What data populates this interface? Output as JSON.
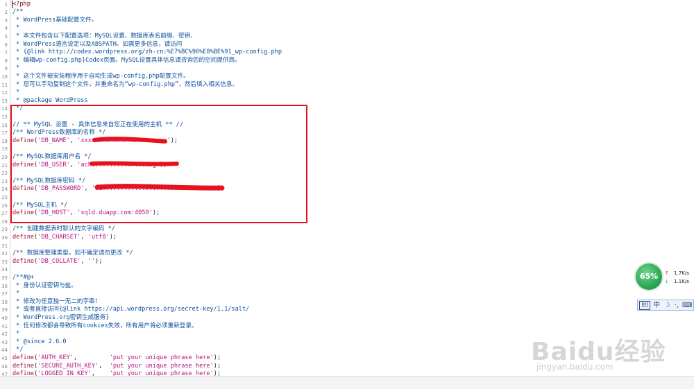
{
  "lines": [
    {
      "n": "1",
      "parts": [
        {
          "c": "keyword",
          "t": "<?php"
        }
      ]
    },
    {
      "n": "2",
      "parts": [
        {
          "c": "comment",
          "t": "/**"
        }
      ]
    },
    {
      "n": "3",
      "parts": [
        {
          "c": "comment",
          "t": " * WordPress基础配置文件。"
        }
      ]
    },
    {
      "n": "4",
      "parts": [
        {
          "c": "comment",
          "t": " *"
        }
      ]
    },
    {
      "n": "5",
      "parts": [
        {
          "c": "comment",
          "t": " * 本文件包含以下配置选项：MySQL设置、数据库表名前缀、密钥、"
        }
      ]
    },
    {
      "n": "6",
      "parts": [
        {
          "c": "comment",
          "t": " * WordPress语言设定以及ABSPATH。如需更多信息，请访问"
        }
      ]
    },
    {
      "n": "7",
      "parts": [
        {
          "c": "comment",
          "t": " * {@link http://codex.wordpress.org/zh-cn:%E7%BC%96%E8%BE%91_wp-config.php"
        }
      ]
    },
    {
      "n": "8",
      "parts": [
        {
          "c": "comment",
          "t": " * 编辑wp-config.php}Codex页面。MySQL设置具体信息请咨询您的空间提供商。"
        }
      ]
    },
    {
      "n": "9",
      "parts": [
        {
          "c": "comment",
          "t": " *"
        }
      ]
    },
    {
      "n": "10",
      "parts": [
        {
          "c": "comment",
          "t": " * 这个文件被安装程序用于自动生成wp-config.php配置文件。"
        }
      ]
    },
    {
      "n": "11",
      "parts": [
        {
          "c": "comment",
          "t": " * 您可以手动复制这个文件，并重命名为“wp-config.php”，然后填入相关信息。"
        }
      ]
    },
    {
      "n": "12",
      "parts": [
        {
          "c": "comment",
          "t": " *"
        }
      ]
    },
    {
      "n": "13",
      "parts": [
        {
          "c": "comment",
          "t": " * @package WordPress"
        }
      ]
    },
    {
      "n": "14",
      "parts": [
        {
          "c": "comment",
          "t": " */"
        }
      ]
    },
    {
      "n": "15",
      "parts": [
        {
          "c": "plain",
          "t": ""
        }
      ]
    },
    {
      "n": "16",
      "parts": [
        {
          "c": "comment",
          "t": "// ** MySQL 设置 - 具体信息来自您正在使用的主机 ** //"
        }
      ]
    },
    {
      "n": "17",
      "parts": [
        {
          "c": "comment",
          "t": "/** WordPress数据库的名称 */"
        }
      ]
    },
    {
      "n": "18",
      "parts": [
        {
          "c": "fn",
          "t": "define"
        },
        {
          "c": "punct",
          "t": "("
        },
        {
          "c": "str",
          "t": "'DB_NAME'"
        },
        {
          "c": "punct",
          "t": ", "
        },
        {
          "c": "str",
          "t": "'xxxxxxxxxxxxxxxxxxxxxxxx'"
        },
        {
          "c": "punct",
          "t": ");"
        }
      ]
    },
    {
      "n": "19",
      "parts": [
        {
          "c": "plain",
          "t": ""
        }
      ]
    },
    {
      "n": "20",
      "parts": [
        {
          "c": "comment",
          "t": "/** MySQL数据库用户名 */"
        }
      ]
    },
    {
      "n": "21",
      "parts": [
        {
          "c": "fn",
          "t": "define"
        },
        {
          "c": "punct",
          "t": "("
        },
        {
          "c": "str",
          "t": "'DB_USER'"
        },
        {
          "c": "punct",
          "t": ", "
        },
        {
          "c": "str",
          "t": "'ach...............8Sg'"
        },
        {
          "c": "punct",
          "t": ");"
        }
      ]
    },
    {
      "n": "22",
      "parts": [
        {
          "c": "plain",
          "t": ""
        }
      ]
    },
    {
      "n": "23",
      "parts": [
        {
          "c": "comment",
          "t": "/** MySQL数据库密码 */"
        }
      ]
    },
    {
      "n": "24",
      "parts": [
        {
          "c": "fn",
          "t": "define"
        },
        {
          "c": "punct",
          "t": "("
        },
        {
          "c": "str",
          "t": "'DB_PASSWORD'"
        },
        {
          "c": "punct",
          "t": ", "
        },
        {
          "c": "str",
          "t": "'o1W..............................'"
        },
        {
          "c": "punct",
          "t": ");"
        }
      ]
    },
    {
      "n": "25",
      "parts": [
        {
          "c": "plain",
          "t": ""
        }
      ]
    },
    {
      "n": "26",
      "parts": [
        {
          "c": "comment",
          "t": "/** MySQL主机 */"
        }
      ]
    },
    {
      "n": "27",
      "parts": [
        {
          "c": "fn",
          "t": "define"
        },
        {
          "c": "punct",
          "t": "("
        },
        {
          "c": "str",
          "t": "'DB_HOST'"
        },
        {
          "c": "punct",
          "t": ", "
        },
        {
          "c": "str",
          "t": "'sqld.duapp.com:4050'"
        },
        {
          "c": "punct",
          "t": ");"
        }
      ]
    },
    {
      "n": "28",
      "parts": [
        {
          "c": "plain",
          "t": ""
        }
      ]
    },
    {
      "n": "29",
      "parts": [
        {
          "c": "comment",
          "t": "/** 创建数据表时默认的文字编码 */"
        }
      ]
    },
    {
      "n": "30",
      "parts": [
        {
          "c": "fn",
          "t": "define"
        },
        {
          "c": "punct",
          "t": "("
        },
        {
          "c": "str",
          "t": "'DB_CHARSET'"
        },
        {
          "c": "punct",
          "t": ", "
        },
        {
          "c": "str",
          "t": "'utf8'"
        },
        {
          "c": "punct",
          "t": ");"
        }
      ]
    },
    {
      "n": "31",
      "parts": [
        {
          "c": "plain",
          "t": ""
        }
      ]
    },
    {
      "n": "32",
      "parts": [
        {
          "c": "comment",
          "t": "/** 数据库整理类型。如不确定请勿更改 */"
        }
      ]
    },
    {
      "n": "33",
      "parts": [
        {
          "c": "fn",
          "t": "define"
        },
        {
          "c": "punct",
          "t": "("
        },
        {
          "c": "str",
          "t": "'DB_COLLATE'"
        },
        {
          "c": "punct",
          "t": ", "
        },
        {
          "c": "str",
          "t": "''"
        },
        {
          "c": "punct",
          "t": ");"
        }
      ]
    },
    {
      "n": "34",
      "parts": [
        {
          "c": "plain",
          "t": ""
        }
      ]
    },
    {
      "n": "35",
      "parts": [
        {
          "c": "comment",
          "t": "/**#@+"
        }
      ]
    },
    {
      "n": "36",
      "parts": [
        {
          "c": "comment",
          "t": " * 身份认证密钥与盐。"
        }
      ]
    },
    {
      "n": "37",
      "parts": [
        {
          "c": "comment",
          "t": " *"
        }
      ]
    },
    {
      "n": "38",
      "parts": [
        {
          "c": "comment",
          "t": " * 修改为任意独一无二的字串！"
        }
      ]
    },
    {
      "n": "39",
      "parts": [
        {
          "c": "comment",
          "t": " * 或者直接访问{@link https://api.wordpress.org/secret-key/1.1/salt/"
        }
      ]
    },
    {
      "n": "40",
      "parts": [
        {
          "c": "comment",
          "t": " * WordPress.org密钥生成服务}"
        }
      ]
    },
    {
      "n": "41",
      "parts": [
        {
          "c": "comment",
          "t": " * 任何修改都会导致所有cookies失效，所有用户将必须重新登录。"
        }
      ]
    },
    {
      "n": "42",
      "parts": [
        {
          "c": "comment",
          "t": " *"
        }
      ]
    },
    {
      "n": "43",
      "parts": [
        {
          "c": "comment",
          "t": " * @since 2.6.0"
        }
      ]
    },
    {
      "n": "44",
      "parts": [
        {
          "c": "comment",
          "t": " */"
        }
      ]
    },
    {
      "n": "45",
      "parts": [
        {
          "c": "fn",
          "t": "define"
        },
        {
          "c": "punct",
          "t": "("
        },
        {
          "c": "str",
          "t": "'AUTH_KEY'"
        },
        {
          "c": "punct",
          "t": ",         "
        },
        {
          "c": "str",
          "t": "'put your unique phrase here'"
        },
        {
          "c": "punct",
          "t": ");"
        }
      ]
    },
    {
      "n": "46",
      "parts": [
        {
          "c": "fn",
          "t": "define"
        },
        {
          "c": "punct",
          "t": "("
        },
        {
          "c": "str",
          "t": "'SECURE_AUTH_KEY'"
        },
        {
          "c": "punct",
          "t": ",  "
        },
        {
          "c": "str",
          "t": "'put your unique phrase here'"
        },
        {
          "c": "punct",
          "t": ");"
        }
      ]
    },
    {
      "n": "47",
      "parts": [
        {
          "c": "fn",
          "t": "define"
        },
        {
          "c": "punct",
          "t": "("
        },
        {
          "c": "str",
          "t": "'LOGGED_IN_KEY'"
        },
        {
          "c": "punct",
          "t": ",    "
        },
        {
          "c": "str",
          "t": "'put your unique phrase here'"
        },
        {
          "c": "punct",
          "t": ");"
        }
      ]
    }
  ],
  "net_widget": {
    "percent": "65%",
    "upload": "1.7K/s",
    "download": "1.1K/s",
    "upload_icon": "arrow-up-icon",
    "download_icon": "arrow-down-icon"
  },
  "ime_bar": {
    "mode_label": "中",
    "items": [
      "ime-logo-icon",
      "moon-icon",
      "punctuation-icon",
      "keyboard-icon"
    ]
  },
  "watermark": {
    "logo": "Baidu经验",
    "sub": "jingyan.baidu.com"
  },
  "colors": {
    "comment": "#0a4f9c",
    "string": "#b3117e",
    "function": "#a0103a",
    "highlight": "#e8121e",
    "redaction": "#e8121e"
  }
}
